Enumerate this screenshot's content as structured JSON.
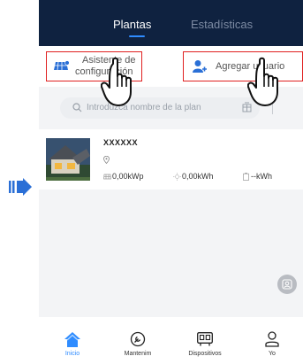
{
  "header": {
    "tabs": [
      {
        "label": "Plantas",
        "active": true
      },
      {
        "label": "Estadísticas",
        "active": false
      }
    ]
  },
  "actions": {
    "setup_wizard_line1": "Asistente de",
    "setup_wizard_line2": "configuración",
    "add_user": "Agregar usuario"
  },
  "search": {
    "placeholder": "Introduzca nombre de la plan"
  },
  "plant": {
    "name": "XXXXXX",
    "capacity": "0,00kWp",
    "energy": "0,00kWh",
    "extra": "--kWh"
  },
  "nav": {
    "items": [
      {
        "label": "Inicio",
        "icon": "home-icon",
        "active": true
      },
      {
        "label": "Mantenim",
        "icon": "maintenance-icon",
        "active": false
      },
      {
        "label": "Dispositivos",
        "icon": "devices-icon",
        "active": false
      },
      {
        "label": "Yo",
        "icon": "user-icon",
        "active": false
      }
    ]
  },
  "colors": {
    "header_bg": "#0f2240",
    "accent": "#2f8cff",
    "highlight": "#e02020",
    "step_arrow": "#2a6fd6"
  }
}
